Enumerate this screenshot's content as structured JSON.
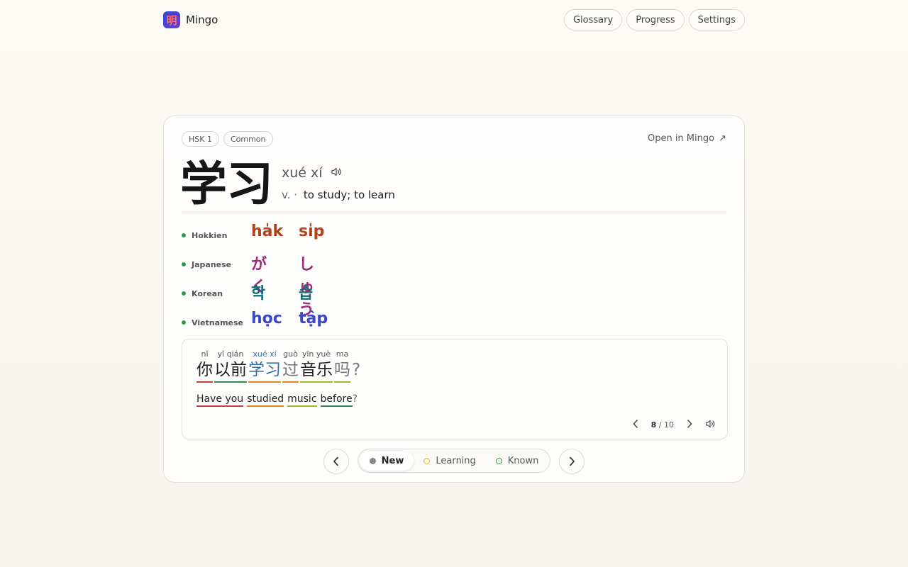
{
  "header": {
    "logo_glyph": "明",
    "brand": "Mingo",
    "nav": [
      "Glossary",
      "Progress",
      "Settings"
    ]
  },
  "card": {
    "tags": [
      "HSK 1",
      "Common"
    ],
    "open_link": "Open in Mingo",
    "hanzi": "学习",
    "pinyin": "xué xí",
    "pos": "v. ·",
    "definition": "to study; to learn",
    "dialects": [
      {
        "label": "Hokkien",
        "syllables": [
          "ha̍k",
          "si̍p"
        ],
        "color": "#b0421a"
      },
      {
        "label": "Japanese",
        "syllables": [
          "がく",
          "しゅう"
        ],
        "color": "#a02a7a"
      },
      {
        "label": "Korean",
        "syllables": [
          "학",
          "습"
        ],
        "color": "#136b76"
      },
      {
        "label": "Vietnamese",
        "syllables": [
          "học",
          "tập"
        ],
        "color": "#3a48c8"
      }
    ]
  },
  "sentence": {
    "words": [
      {
        "py": "nǐ",
        "cn": "你",
        "color": "#c9413a",
        "text_color": "#222"
      },
      {
        "py": "yǐ qián",
        "cn": "以前",
        "color": "#2e8b4e",
        "text_color": "#222"
      },
      {
        "py": "xué xí",
        "cn": "学习",
        "color": "#e08a1e",
        "text_color": "#3b6fa8"
      },
      {
        "py": "guò",
        "cn": "过",
        "color": "#e08a1e",
        "text_color": "#777"
      },
      {
        "py": "yīn yuè",
        "cn": "音乐",
        "color": "#9cb832",
        "text_color": "#222"
      },
      {
        "py": "ma",
        "cn": "吗",
        "color": "#9cb832",
        "text_color": "#777"
      }
    ],
    "end_punct": "?",
    "english": [
      {
        "text": "Have you",
        "color": "#c9413a"
      },
      {
        "text": "studied",
        "color": "#e08a1e"
      },
      {
        "text": "music",
        "color": "#9cb832"
      },
      {
        "text": "before",
        "color": "#2e8b4e"
      }
    ],
    "english_end": "?",
    "current": "8",
    "total": "/ 10"
  },
  "status": {
    "options": [
      {
        "label": "New",
        "color": "#888888",
        "active": true
      },
      {
        "label": "Learning",
        "color": "#e6b422",
        "active": false
      },
      {
        "label": "Known",
        "color": "#2e9b4e",
        "active": false
      }
    ]
  }
}
